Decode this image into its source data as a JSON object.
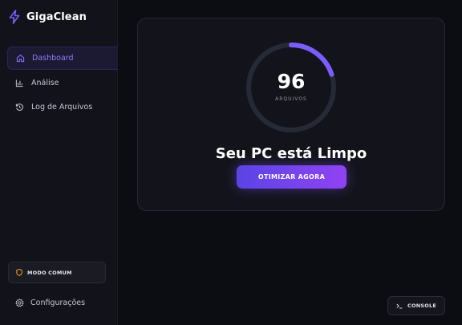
{
  "app": {
    "name": "GigaClean"
  },
  "sidebar": {
    "items": [
      {
        "label": "Dashboard",
        "icon": "home-icon",
        "active": true
      },
      {
        "label": "Análise",
        "icon": "bar-chart-icon",
        "active": false
      },
      {
        "label": "Log de Arquivos",
        "icon": "history-icon",
        "active": false
      }
    ],
    "mode_label": "MODO COMUM",
    "settings_label": "Configurações"
  },
  "dashboard": {
    "file_count": "96",
    "file_count_label": "ARQUIVOS",
    "progress_fraction": 0.2,
    "status_title": "Seu PC está Limpo",
    "optimize_label": "OTIMIZAR AGORA"
  },
  "console": {
    "label": "CONSOLE"
  },
  "colors": {
    "accent": "#7b5cff",
    "accent_gradient_end": "#9043f2",
    "mode_icon": "#f5a623",
    "background": "#0c0d12",
    "sidebar": "#12131a"
  }
}
